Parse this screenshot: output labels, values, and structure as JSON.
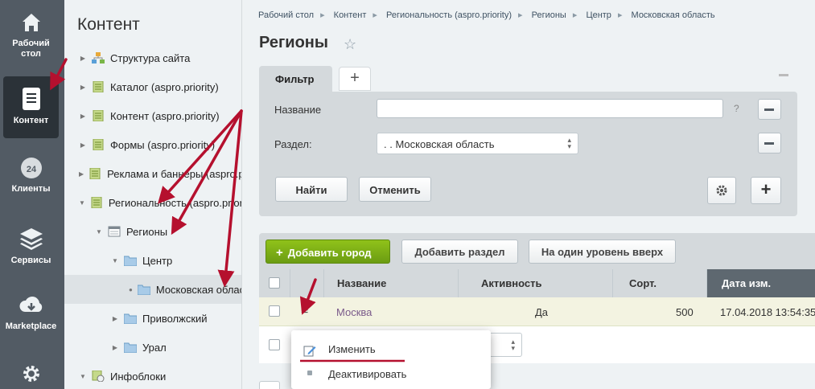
{
  "left_nav": [
    {
      "label": "Рабочий стол",
      "icon": "home-icon"
    },
    {
      "label": "Контент",
      "icon": "document-icon"
    },
    {
      "label": "Клиенты",
      "icon": "clients-24-icon"
    },
    {
      "label": "Сервисы",
      "icon": "layers-icon"
    },
    {
      "label": "Marketplace",
      "icon": "cloud-download-icon"
    },
    {
      "label": "",
      "icon": "gear-icon"
    }
  ],
  "tree": {
    "title": "Контент",
    "items": [
      {
        "label": "Структура сайта",
        "icon": "sitemap-icon"
      },
      {
        "label": "Каталог (aspro.priority)",
        "icon": "iblock-icon"
      },
      {
        "label": "Контент (aspro.priority)",
        "icon": "iblock-icon"
      },
      {
        "label": "Формы (aspro.priority)",
        "icon": "iblock-icon"
      },
      {
        "label": "Реклама и баннеры (aspro.priority)",
        "icon": "iblock-icon"
      },
      {
        "label": "Региональность (aspro.priority)",
        "icon": "iblock-icon"
      },
      {
        "label": "Регионы",
        "icon": "list-icon"
      },
      {
        "label": "Центр",
        "icon": "folder-icon"
      },
      {
        "label": "Московская область",
        "icon": "folder-icon"
      },
      {
        "label": "Приволжский",
        "icon": "folder-icon"
      },
      {
        "label": "Урал",
        "icon": "folder-icon"
      },
      {
        "label": "Инфоблоки",
        "icon": "iblocks-icon"
      }
    ]
  },
  "breadcrumb": [
    "Рабочий стол",
    "Контент",
    "Региональность (aspro.priority)",
    "Регионы",
    "Центр",
    "Московская область"
  ],
  "page": {
    "title": "Регионы"
  },
  "filter": {
    "tab_label": "Фильтр",
    "add_tab": "+",
    "name_label": "Название",
    "name_value": "",
    "help": "?",
    "section_label": "Раздел:",
    "section_value": ". . Московская область",
    "find_label": "Найти",
    "cancel_label": "Отменить"
  },
  "toolbar": {
    "add_city": "Добавить город",
    "add_section": "Добавить раздел",
    "level_up": "На один уровень вверх"
  },
  "table": {
    "columns": [
      "Название",
      "Активность",
      "Сорт.",
      "Дата изм."
    ],
    "rows": [
      {
        "name": "Москва",
        "active": "Да",
        "sort": "500",
        "date": "17.04.2018 13:54:35"
      }
    ]
  },
  "context_menu": {
    "items": [
      {
        "label": "Изменить",
        "icon": "edit-icon"
      },
      {
        "label": "Деактивировать",
        "icon": "dot-icon"
      }
    ]
  },
  "colors": {
    "annotation": "#b5102e",
    "add_button": "#7aac14",
    "sidebar": "#525b64"
  }
}
